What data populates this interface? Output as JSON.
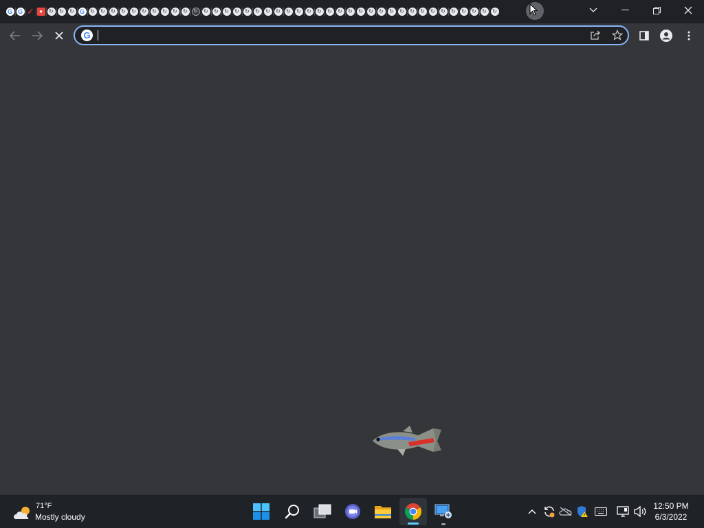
{
  "browser": {
    "tabs": [
      {
        "icon": "google-icon"
      },
      {
        "icon": "google-icon"
      },
      {
        "icon": "checkmark-icon"
      },
      {
        "icon": "reddit-icon"
      },
      {
        "icon": "loading-icon"
      },
      {
        "icon": "loading-icon"
      },
      {
        "icon": "loading-icon"
      },
      {
        "icon": "google-icon"
      },
      {
        "icon": "loading-icon"
      },
      {
        "icon": "loading-icon"
      },
      {
        "icon": "loading-icon"
      },
      {
        "icon": "loading-icon"
      },
      {
        "icon": "loading-icon"
      },
      {
        "icon": "loading-icon"
      },
      {
        "icon": "loading-icon"
      },
      {
        "icon": "loading-icon"
      },
      {
        "icon": "loading-icon"
      },
      {
        "icon": "loading-icon"
      },
      {
        "icon": "grey-loading-icon"
      },
      {
        "icon": "loading-icon"
      },
      {
        "icon": "loading-icon"
      },
      {
        "icon": "loading-icon"
      },
      {
        "icon": "loading-icon"
      },
      {
        "icon": "loading-icon"
      },
      {
        "icon": "loading-icon"
      },
      {
        "icon": "loading-icon"
      },
      {
        "icon": "loading-icon"
      },
      {
        "icon": "loading-icon"
      },
      {
        "icon": "loading-icon"
      },
      {
        "icon": "loading-icon"
      },
      {
        "icon": "loading-icon"
      },
      {
        "icon": "loading-icon"
      },
      {
        "icon": "loading-icon"
      },
      {
        "icon": "loading-icon"
      },
      {
        "icon": "loading-icon"
      },
      {
        "icon": "loading-icon"
      },
      {
        "icon": "loading-icon"
      },
      {
        "icon": "loading-icon"
      },
      {
        "icon": "loading-icon"
      },
      {
        "icon": "loading-icon"
      },
      {
        "icon": "loading-icon"
      },
      {
        "icon": "loading-icon"
      },
      {
        "icon": "loading-icon"
      },
      {
        "icon": "loading-icon"
      },
      {
        "icon": "loading-icon"
      },
      {
        "icon": "loading-icon"
      },
      {
        "icon": "loading-icon"
      },
      {
        "icon": "loading-icon"
      }
    ],
    "omnibox": {
      "value": "",
      "placeholder": ""
    },
    "colors": {
      "frame": "#202124",
      "toolbar": "#35363a",
      "focus_ring": "#8ab4f8"
    }
  },
  "page": {
    "background": "#35363a",
    "decoration": "neon-tetra-fish"
  },
  "taskbar": {
    "weather": {
      "temp": "71°F",
      "condition": "Mostly cloudy",
      "icon": "partly-cloudy-icon"
    },
    "apps": [
      {
        "name": "start",
        "icon": "windows-start-icon"
      },
      {
        "name": "search",
        "icon": "search-icon"
      },
      {
        "name": "task-view",
        "icon": "task-view-icon"
      },
      {
        "name": "chat",
        "icon": "teams-chat-icon"
      },
      {
        "name": "file-explorer",
        "icon": "folder-icon"
      },
      {
        "name": "chrome",
        "icon": "chrome-icon",
        "active": true
      },
      {
        "name": "remote-desktop",
        "icon": "remote-desktop-icon"
      }
    ],
    "tray": [
      "chevron-up-icon",
      "sync-icon",
      "onedrive-icon",
      "defender-icon",
      "keyboard-icon",
      "network-icon",
      "volume-icon"
    ],
    "clock": {
      "time": "12:50 PM",
      "date": "6/3/2022"
    }
  }
}
